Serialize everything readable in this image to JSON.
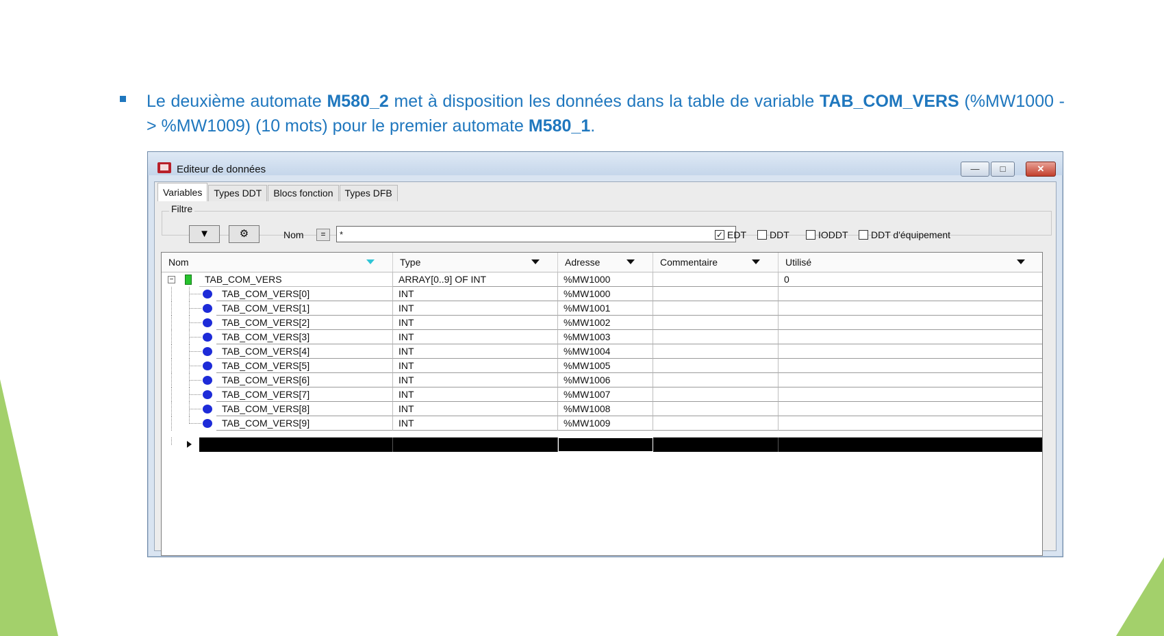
{
  "slide": {
    "bullet_parts": [
      {
        "text": "Le deuxième automate ",
        "bold": false
      },
      {
        "text": "M580_2",
        "bold": true
      },
      {
        "text": " met à disposition les données dans la table de variable ",
        "bold": false
      },
      {
        "text": "TAB_COM_VERS",
        "bold": true
      },
      {
        "text": " (%MW1000 -> %MW1009) (10 mots) pour le premier automate ",
        "bold": false
      },
      {
        "text": "M580_1",
        "bold": true
      },
      {
        "text": ".",
        "bold": false
      }
    ],
    "accent_color": "#1f77be",
    "decor_color": "#a3d06b"
  },
  "window": {
    "title": "Editeur de données",
    "min_icon": "minimize-icon",
    "max_icon": "maximize-icon",
    "close_icon": "close-icon"
  },
  "tabs": [
    "Variables",
    "Types DDT",
    "Blocs fonction",
    "Types DFB"
  ],
  "filter": {
    "label": "Filtre",
    "nom_label": "Nom",
    "eq": "=",
    "nom_value": "*",
    "checkboxes": [
      {
        "label": "EDT",
        "checked": true
      },
      {
        "label": "DDT",
        "checked": false
      },
      {
        "label": "IODDT",
        "checked": false
      },
      {
        "label": "DDT d'équipement",
        "checked": false
      }
    ]
  },
  "grid": {
    "columns": [
      "Nom",
      "Type",
      "Adresse",
      "Commentaire",
      "Utilisé"
    ],
    "parent": {
      "name": "TAB_COM_VERS",
      "type": "ARRAY[0..9] OF INT",
      "address": "%MW1000",
      "comment": "",
      "used": "0"
    },
    "rows": [
      {
        "name": "TAB_COM_VERS[0]",
        "type": "INT",
        "address": "%MW1000"
      },
      {
        "name": "TAB_COM_VERS[1]",
        "type": "INT",
        "address": "%MW1001"
      },
      {
        "name": "TAB_COM_VERS[2]",
        "type": "INT",
        "address": "%MW1002"
      },
      {
        "name": "TAB_COM_VERS[3]",
        "type": "INT",
        "address": "%MW1003"
      },
      {
        "name": "TAB_COM_VERS[4]",
        "type": "INT",
        "address": "%MW1004"
      },
      {
        "name": "TAB_COM_VERS[5]",
        "type": "INT",
        "address": "%MW1005"
      },
      {
        "name": "TAB_COM_VERS[6]",
        "type": "INT",
        "address": "%MW1006"
      },
      {
        "name": "TAB_COM_VERS[7]",
        "type": "INT",
        "address": "%MW1007"
      },
      {
        "name": "TAB_COM_VERS[8]",
        "type": "INT",
        "address": "%MW1008"
      },
      {
        "name": "TAB_COM_VERS[9]",
        "type": "INT",
        "address": "%MW1009"
      }
    ]
  }
}
